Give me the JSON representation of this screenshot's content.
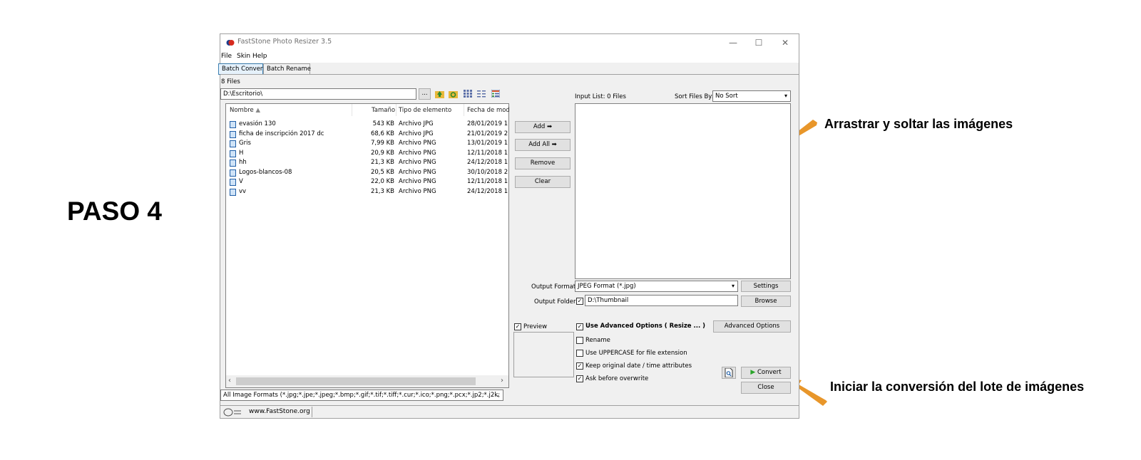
{
  "annotations": {
    "step": "PASO 4",
    "drag_note": "Arrastrar y soltar las imágenes",
    "convert_note": "Iniciar la conversión del lote de imágenes",
    "arrow_color": "#E8962A"
  },
  "window": {
    "title": "FastStone Photo Resizer 3.5",
    "controls": {
      "minimize": "—",
      "maximize": "☐",
      "close": "✕"
    }
  },
  "menu": [
    "File",
    "Skin",
    "Help"
  ],
  "tabs": [
    {
      "label": "Batch Convert",
      "active": true
    },
    {
      "label": "Batch Rename",
      "active": false
    }
  ],
  "browser": {
    "count": "8 Files",
    "path": "D:\\Escritorio\\",
    "browse_btn": "...",
    "icons": [
      "folder-up-icon",
      "refresh-icon",
      "thumbnail-view-icon",
      "list-view-icon",
      "details-view-icon"
    ],
    "columns": [
      "Nombre",
      "Tamaño",
      "Tipo de elemento",
      "Fecha de mod"
    ],
    "files": [
      {
        "name": "evasión 130",
        "size": "543 KB",
        "type": "Archivo JPG",
        "date": "28/01/2019 1"
      },
      {
        "name": "ficha de inscripción 2017 dc",
        "size": "68,6 KB",
        "type": "Archivo JPG",
        "date": "21/01/2019 2"
      },
      {
        "name": "Gris",
        "size": "7,99 KB",
        "type": "Archivo PNG",
        "date": "13/01/2019 1"
      },
      {
        "name": "H",
        "size": "20,9 KB",
        "type": "Archivo PNG",
        "date": "12/11/2018 1"
      },
      {
        "name": "hh",
        "size": "21,3 KB",
        "type": "Archivo PNG",
        "date": "24/12/2018 1"
      },
      {
        "name": "Logos-blancos-08",
        "size": "20,5 KB",
        "type": "Archivo PNG",
        "date": "30/10/2018 2"
      },
      {
        "name": "V",
        "size": "22,0 KB",
        "type": "Archivo PNG",
        "date": "12/11/2018 1"
      },
      {
        "name": "vv",
        "size": "21,3 KB",
        "type": "Archivo PNG",
        "date": "24/12/2018 1"
      }
    ],
    "filter": "All Image Formats (*.jpg;*.jpe;*.jpeg;*.bmp;*.gif;*.tif;*.tiff;*.cur;*.ico;*.png;*.pcx;*.jp2;*.j2k;"
  },
  "actions": {
    "add": "Add ➡",
    "add_all": "Add All ➡",
    "remove": "Remove",
    "clear": "Clear"
  },
  "input": {
    "label": "Input List:  0 Files",
    "sort_label": "Sort Files By:",
    "sort_value": "No Sort"
  },
  "output": {
    "format_label": "Output Format:",
    "format_value": "JPEG Format (*.jpg)",
    "settings_btn": "Settings",
    "folder_label": "Output Folder:",
    "folder_checked": true,
    "folder_value": "D:\\Thumbnail",
    "browse_btn": "Browse"
  },
  "options": {
    "preview_label": "Preview",
    "preview_checked": true,
    "advanced_label": "Use Advanced Options ( Resize ... )",
    "advanced_checked": true,
    "advanced_btn": "Advanced Options",
    "rename_label": "Rename",
    "rename_checked": false,
    "uppercase_label": "Use UPPERCASE for file extension",
    "uppercase_checked": false,
    "keepdate_label": "Keep original date / time attributes",
    "keepdate_checked": true,
    "overwrite_label": "Ask before overwrite",
    "overwrite_checked": true
  },
  "buttons": {
    "convert": "Convert",
    "close": "Close"
  },
  "status": {
    "url": "www.FastStone.org"
  }
}
